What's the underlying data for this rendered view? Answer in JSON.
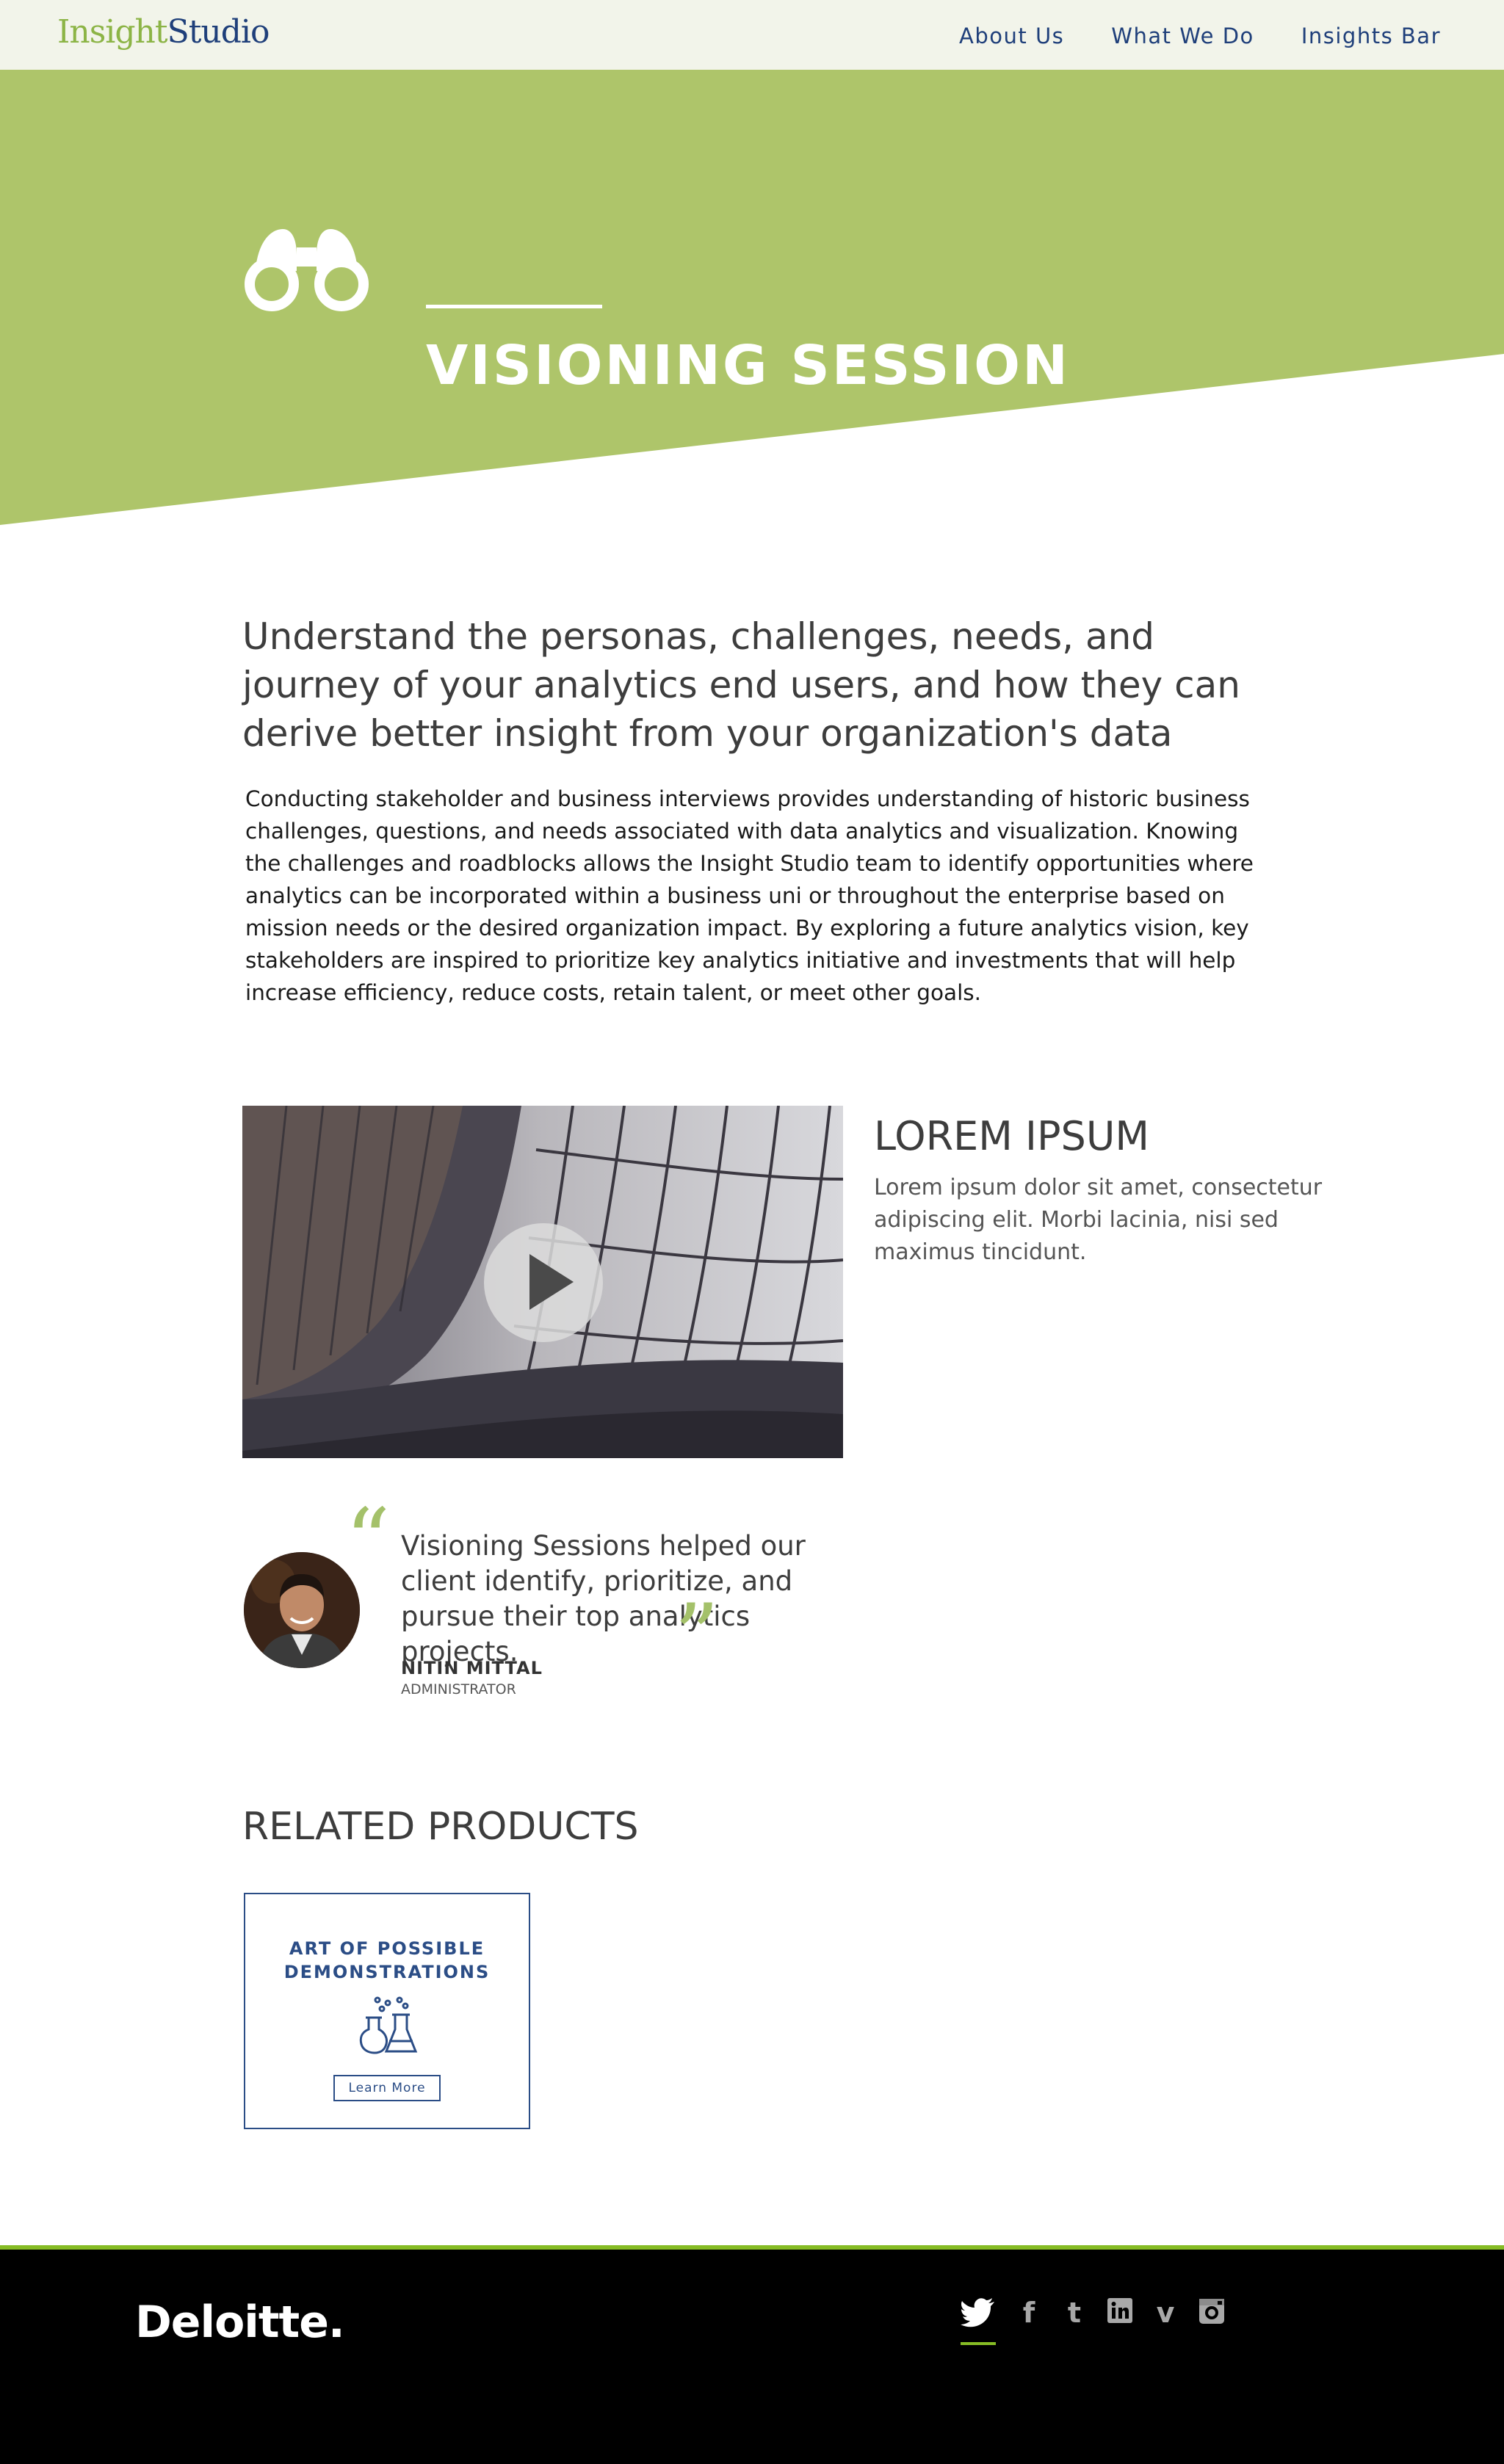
{
  "nav": {
    "logo_part1": "Insight",
    "logo_part2": "Studio",
    "links": [
      "About Us",
      "What We Do",
      "Insights Bar"
    ]
  },
  "hero": {
    "title": "VISIONING SESSION",
    "icon": "binoculars-icon",
    "accent_color": "#aec56a"
  },
  "intro": {
    "headline": "Understand the personas, challenges, needs, and journey of your analytics end users, and how they can derive better insight from your organization's data",
    "body": "Conducting stakeholder and business interviews provides understanding of historic business challenges, questions, and needs associated with data analytics and visualization. Knowing the challenges and roadblocks allows the Insight Studio team to identify opportunities where analytics can be incorporated within a business uni or throughout the enterprise based on mission needs or the desired organization impact. By exploring a future analytics vision, key stakeholders are inspired to prioritize key analytics initiative and investments that will help increase efficiency, reduce costs, retain talent, or meet other goals."
  },
  "feature": {
    "title": "LOREM IPSUM",
    "text": "Lorem ipsum dolor sit amet, consectetur adipiscing elit. Morbi lacinia, nisi sed maximus tincidunt."
  },
  "testimonial": {
    "quote": "Visioning Sessions helped our client identify, prioritize, and pursue their top analytics projects.",
    "author": "NITIN MITTAL",
    "role": "ADMINISTRATOR"
  },
  "related": {
    "title": "RELATED PRODUCTS",
    "cards": [
      {
        "title": "ART OF POSSIBLE DEMONSTRATIONS",
        "button": "Learn More",
        "icon": "flask-icon"
      }
    ]
  },
  "footer": {
    "brand": "Deloitte.",
    "social": [
      "twitter-icon",
      "facebook-icon",
      "tumblr-icon",
      "linkedin-icon",
      "vimeo-icon",
      "instagram-icon"
    ],
    "accent_color": "#86bc25"
  }
}
